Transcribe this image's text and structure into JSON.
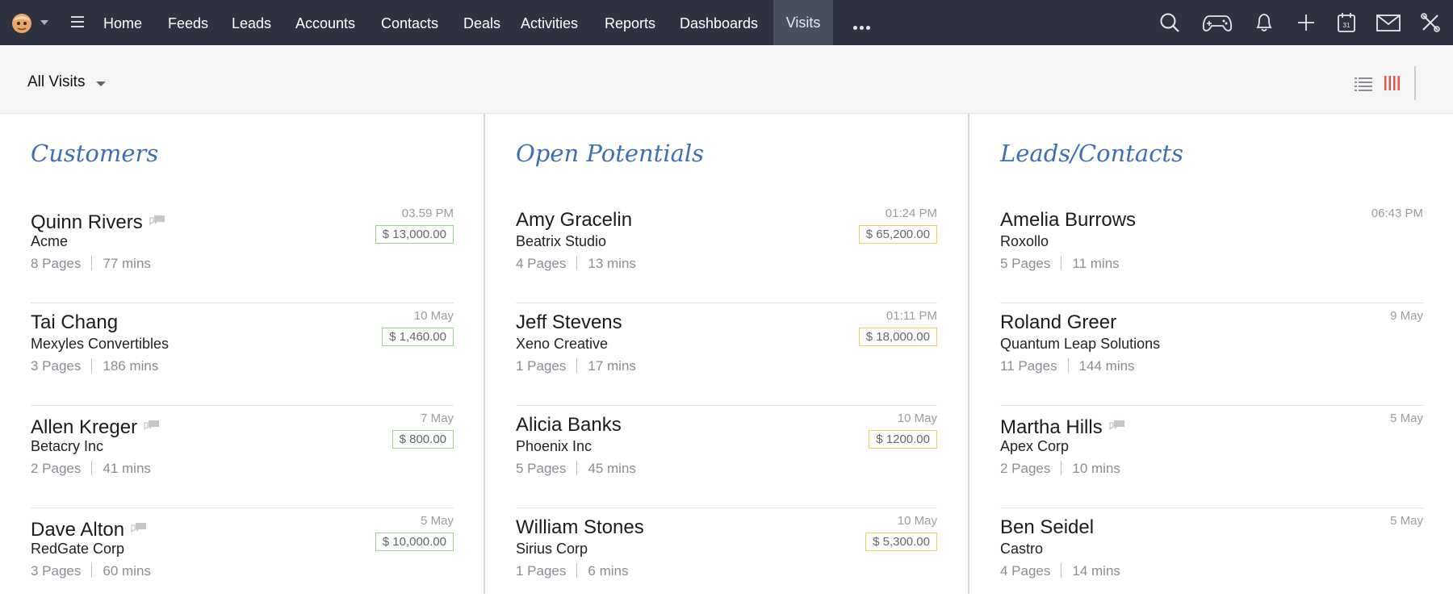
{
  "nav": {
    "items": [
      {
        "label": "Home"
      },
      {
        "label": "Feeds"
      },
      {
        "label": "Leads"
      },
      {
        "label": "Accounts"
      },
      {
        "label": "Contacts"
      },
      {
        "label": "Deals"
      },
      {
        "label": "Activities"
      },
      {
        "label": "Reports"
      },
      {
        "label": "Dashboards"
      },
      {
        "label": "Visits",
        "active": true
      }
    ],
    "icons": [
      "search-icon",
      "gamepad-icon",
      "bell-icon",
      "plus-icon",
      "calendar-icon",
      "mail-icon",
      "tools-icon"
    ],
    "calendar_day": "31"
  },
  "subheader": {
    "view_label": "All Visits"
  },
  "colors": {
    "nav_bg": "#2f3341",
    "column_title": "#3e6fb3",
    "amount_green": "#9ed28f",
    "amount_yellow": "#f0cf5a",
    "kanban_icon": "#e2574c"
  },
  "columns": [
    {
      "title": "Customers",
      "cards": [
        {
          "name": "Quinn Rivers",
          "has_note": true,
          "company": "Acme",
          "pages": "8 Pages",
          "duration": "77 mins",
          "time": "03.59 PM",
          "amount": "$ 13,000.00",
          "amount_style": "green"
        },
        {
          "name": "Tai Chang",
          "has_note": false,
          "company": "Mexyles Convertibles",
          "pages": "3 Pages",
          "duration": "186 mins",
          "time": "10 May",
          "amount": "$ 1,460.00",
          "amount_style": "green"
        },
        {
          "name": "Allen Kreger",
          "has_note": true,
          "company": "Betacry Inc",
          "pages": "2 Pages",
          "duration": "41 mins",
          "time": "7 May",
          "amount": "$ 800.00",
          "amount_style": "green"
        },
        {
          "name": "Dave Alton",
          "has_note": true,
          "company": "RedGate Corp",
          "pages": "3 Pages",
          "duration": "60 mins",
          "time": "5 May",
          "amount": "$ 10,000.00",
          "amount_style": "green"
        }
      ]
    },
    {
      "title": "Open Potentials",
      "cards": [
        {
          "name": "Amy Gracelin",
          "has_note": false,
          "company": "Beatrix Studio",
          "pages": "4 Pages",
          "duration": "13 mins",
          "time": "01:24 PM",
          "amount": "$ 65,200.00",
          "amount_style": "yellow"
        },
        {
          "name": "Jeff Stevens",
          "has_note": false,
          "company": "Xeno Creative",
          "pages": "1 Pages",
          "duration": "17 mins",
          "time": "01:11 PM",
          "amount": "$ 18,000.00",
          "amount_style": "yellow"
        },
        {
          "name": "Alicia Banks",
          "has_note": false,
          "company": "Phoenix Inc",
          "pages": "5 Pages",
          "duration": "45 mins",
          "time": "10 May",
          "amount": "$ 1200.00",
          "amount_style": "yellow"
        },
        {
          "name": "William Stones",
          "has_note": false,
          "company": "Sirius Corp",
          "pages": "1 Pages",
          "duration": "6 mins",
          "time": "10 May",
          "amount": "$ 5,300.00",
          "amount_style": "yellow"
        }
      ]
    },
    {
      "title": "Leads/Contacts",
      "cards": [
        {
          "name": "Amelia Burrows",
          "has_note": false,
          "company": "Roxollo",
          "pages": "5 Pages",
          "duration": "11 mins",
          "time": "06:43 PM",
          "amount": null
        },
        {
          "name": "Roland Greer",
          "has_note": false,
          "company": "Quantum Leap Solutions",
          "pages": "11 Pages",
          "duration": "144 mins",
          "time": "9 May",
          "amount": null
        },
        {
          "name": "Martha Hills",
          "has_note": true,
          "company": "Apex Corp",
          "pages": "2 Pages",
          "duration": "10 mins",
          "time": "5 May",
          "amount": null
        },
        {
          "name": "Ben Seidel",
          "has_note": false,
          "company": "Castro",
          "pages": "4 Pages",
          "duration": "14 mins",
          "time": "5 May",
          "amount": null
        }
      ]
    }
  ]
}
